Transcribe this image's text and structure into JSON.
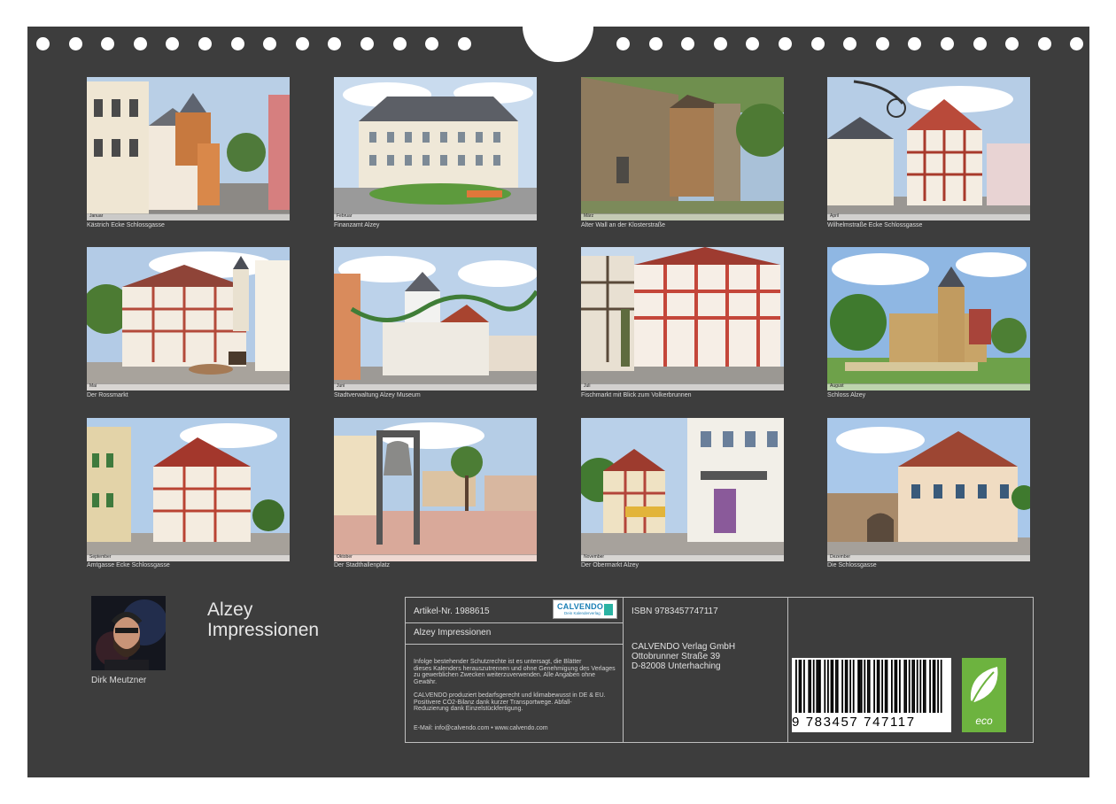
{
  "photos": [
    {
      "caption": "Kästrich Ecke Schlossgasse",
      "month": "Januar"
    },
    {
      "caption": "Finanzamt Alzey",
      "month": "Februar"
    },
    {
      "caption": "Alter Wall an der Klosterstraße",
      "month": "März"
    },
    {
      "caption": "Wilhelmstraße Ecke Schlossgasse",
      "month": "April"
    },
    {
      "caption": "Der Rossmarkt",
      "month": "Mai"
    },
    {
      "caption": "Stadtverwaltung Alzey Museum",
      "month": "Juni"
    },
    {
      "caption": "Fischmarkt mit Blick zum Volkerbrunnen",
      "month": "Juli"
    },
    {
      "caption": "Schloss Alzey",
      "month": "August"
    },
    {
      "caption": "Amtgasse Ecke Schlossgasse",
      "month": "September"
    },
    {
      "caption": "Der Stadthallenplatz",
      "month": "Oktober"
    },
    {
      "caption": "Der Obermarkt Alzey",
      "month": "November"
    },
    {
      "caption": "Die Schlossgasse",
      "month": "Dezember"
    }
  ],
  "author": {
    "name": "Dirk Meutzner"
  },
  "title": {
    "line1": "Alzey",
    "line2": "Impressionen"
  },
  "info": {
    "article": "Artikel-Nr. 1988615",
    "product_title": "Alzey Impressionen",
    "legal1": [
      "Infolge bestehender Schutzrechte ist es untersagt, die Blätter",
      "dieses Kalenders herauszutrennen und ohne Genehmigung des Verlages",
      "zu gewerblichen Zwecken weiterzuverwenden. Alle Angaben ohne",
      "Gewähr."
    ],
    "legal2": [
      "CALVENDO produziert bedarfsgerecht und klimabewusst in DE & EU.",
      "Positivere CO2-Bilanz dank kurzer Transportwege. Abfall-",
      "Reduzierung dank Einzelstückfertigung."
    ],
    "contact": "E-Mail: info@calvendo.com • www.calvendo.com",
    "logo_brand": "CALVENDO",
    "logo_tagline": "Dein Kalenderverlag",
    "isbn": "ISBN 9783457747117",
    "publisher": "CALVENDO Verlag GmbH",
    "street": "Ottobrunner Straße 39",
    "city": "D-82008 Unterhaching",
    "barcode_digits": "9 783457 747117",
    "eco_label": "eco"
  }
}
